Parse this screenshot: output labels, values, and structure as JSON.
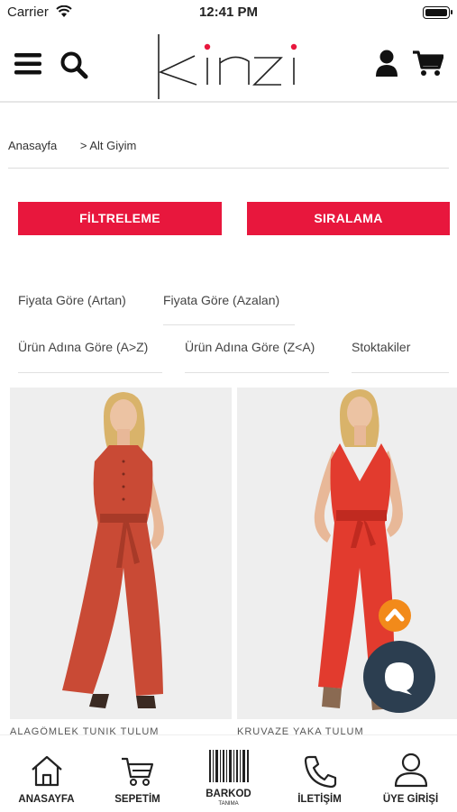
{
  "status": {
    "carrier": "Carrier",
    "time": "12:41 PM"
  },
  "header": {
    "logo": "kinzi",
    "menu_icon": "hamburger-icon",
    "search_icon": "search-icon",
    "user_icon": "user-icon",
    "cart_icon": "cart-icon"
  },
  "breadcrumb": {
    "home": "Anasayfa",
    "current": "> Alt Giyim"
  },
  "buttons": {
    "filter": "FİLTRELEME",
    "sort": "SIRALAMA"
  },
  "sort_options": [
    "Fiyata Göre (Artan)",
    "Fiyata Göre (Azalan)",
    "Ürün Adına Göre (A>Z)",
    "Ürün Adına Göre (Z<A)",
    "Stoktakiler"
  ],
  "products": [
    {
      "name": "ALAGÖMLEK TUNIK TULUM",
      "color": "#c94a35"
    },
    {
      "name": "KRUVAZE YAKA TULUM",
      "color": "#e23b2e"
    }
  ],
  "colors": {
    "accent": "#e8173d",
    "chat": "#2c3e50",
    "scroll_top": "#f28a1a"
  },
  "tabbar": {
    "home": "ANASAYFA",
    "cart": "SEPETİM",
    "barcode": "BARKOD",
    "barcode_sub": "TANIMA",
    "contact": "İLETİŞİM",
    "login": "ÜYE GİRİŞİ"
  }
}
